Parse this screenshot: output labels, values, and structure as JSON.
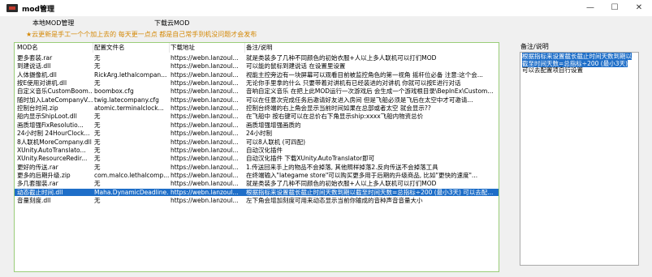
{
  "window": {
    "title": "mod管理",
    "controls": {
      "minimize": "—",
      "maximize": "☐",
      "close": "✕"
    }
  },
  "menu": [
    "本地MOD管理",
    "下载云MOD"
  ],
  "announcement": "★云更新是手工一个个加上去的 每天更一点点 都是自己常手到机没问题才会发布",
  "table": {
    "columns": [
      "MOD名",
      "配置文件名",
      "下载地址",
      "备注/说明"
    ],
    "rows": [
      [
        "更多套装.rar",
        "无",
        "https://webn.lanzoul...",
        "就是类装多了几种不同颜色的初始衣服+人以上多人联机可以打们MOD"
      ],
      [
        "到建说话.dll",
        "无",
        "https://webn.lanzoul...",
        "可以能的鼠标到建说话 在设置里设置"
      ],
      [
        "人体摄像机.dll",
        "RickArg.lethalcompan...",
        "https://webn.lanzoul...",
        "视能主控旁边有一块屏幕可以观看目前被监控角色的第一视角    摇杆位必备 注意:这个会..."
      ],
      [
        "按E使用对讲机.dll",
        "无",
        "https://webn.lanzoul...",
        "无论你手里拿的什么 只要带着对讲机有已经装进的对讲机  你就可以按E进行对话"
      ],
      [
        "自定义音乐CustomBoom...",
        "boombox.cfg",
        "https://webn.lanzoul...",
        "音响自定义音乐   在把上此MOD运行一次游戏后 会生成一个游戏根目录\\BepInEx\\Custom..."
      ],
      [
        "随时加入LateCompanyV...",
        "twig.latecompany.cfg",
        "https://webn.lanzoul...",
        "可以在任意次完成任务后邀请好友进入房间   但是飞船必须是飞后在太空中才可邀请..."
      ],
      [
        "控制台时间.zip",
        "atomic.terminalclock...",
        "https://webn.lanzoul...",
        "控制台终端的右上角会显示当前时间如果在总部或者太空 就会显示??"
      ],
      [
        "船内显示ShipLoot.dll",
        "无",
        "https://webn.lanzoul...",
        "在飞船中   按右键可以在总价右下角显示ship:xxxx飞船内物资总价"
      ],
      [
        "画质增强FixResolutio...",
        "无",
        "https://webn.lanzoul...",
        "画质增强增强画质的"
      ],
      [
        "24小时制 24HourClock...",
        "无",
        "https://webn.lanzoul...",
        "24小时制"
      ],
      [
        "8人联机MoreCompany.dll",
        "无",
        "https://webn.lanzoul...",
        "可以8人联机 (可四配)"
      ],
      [
        "XUnity.AutoTranslato...",
        "无",
        "https://webn.lanzoul...",
        "自动汉化插件"
      ],
      [
        "XUnity.ResourceRedir...",
        "无",
        "https://webn.lanzoul...",
        "自动汉化插件  下载XUnity.AutoTranslator即可"
      ],
      [
        "更好的传送.rar",
        "无",
        "https://webn.lanzoul...",
        "1.传送回来手上的物品不会掉落, 其他照样掉落2.反向传送不会掉落工具"
      ],
      [
        "更多的后期升级.zip",
        "com.malco.lethalcomp...",
        "https://webn.lanzoul...",
        "在终端输入\"lategame store\"可以购买更多用于后期的升级商品, 比如\"更快的速度\"..."
      ],
      [
        "多几套服装.rar",
        "无",
        "https://webn.lanzoul...",
        "就是类装多了几种不同颜色的初始衣服+人以上多人联机可以打们MOD"
      ],
      [
        "动态截止时间.dll",
        "Maha.DynamicDeadline...",
        "https://webn.lanzoul...",
        "根据指标来设置截长截止时间天数到期以截至时间天数=总指标÷200 (最小3天) 可以去配..."
      ],
      [
        "音量刻度.dll",
        "无",
        "https://webn.lanzoul...",
        "左下角会增加刻度可用来动态显示当前你输成的音种声音音量大小"
      ]
    ],
    "selected_row_index": 16
  },
  "notes": {
    "label": "备注/说明",
    "selected_text": "根据指标来设置截长截止时间天数到期以截至时间天数=总指标÷200 (最小3天)",
    "rest_text": "可以去配置项自行设置"
  },
  "colors": {
    "accent": "#1e6ec8",
    "announce": "#d48806",
    "panel_border": "#9acd78"
  },
  "icons": {
    "app": "app-icon",
    "minimize": "minimize-icon",
    "maximize": "maximize-icon",
    "close": "close-icon"
  }
}
